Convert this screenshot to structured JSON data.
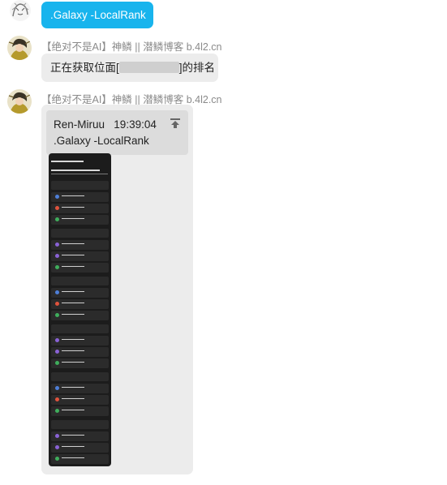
{
  "messages": [
    {
      "text": ".Galaxy -LocalRank"
    },
    {
      "sender": "【绝对不是AI】神鳞 || 潜鳞博客 b.4l2.cn",
      "text_prefix": "正在获取位面[",
      "text_suffix": "]的排名"
    },
    {
      "sender": "【绝对不是AI】神鳞 || 潜鳞博客 b.4l2.cn",
      "quote": {
        "author": "Ren-Miruu",
        "time": "19:39:04",
        "text": ".Galaxy -LocalRank"
      }
    }
  ],
  "colors": {
    "accent": "#18b4ed",
    "bubble": "#ececec",
    "quote_bg": "#dcdcdc"
  },
  "icons": {
    "quote_jump": "arrow-up-to-top-icon"
  }
}
